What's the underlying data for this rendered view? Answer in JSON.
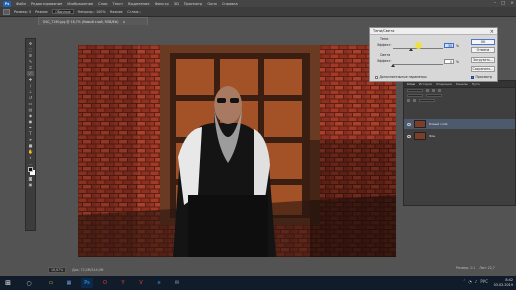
{
  "menubar": {
    "logo": "Ps",
    "items": [
      "Файл",
      "Редактирование",
      "Изображение",
      "Слои",
      "Текст",
      "Выделение",
      "Фильтр",
      "3D",
      "Просмотр",
      "Окно",
      "Справка"
    ]
  },
  "optionsbar": {
    "fields": [
      "Размер: 5",
      "Режим:",
      "Непрозр.: 100%",
      "Нажим:",
      "Сглаж.:"
    ],
    "mode_value": "Обычные"
  },
  "document": {
    "tab_title": "DSC_7190.jpg @ 16,7% (Новый слой, RGB/8#)",
    "close": "×"
  },
  "status": {
    "zoom": "16,67%",
    "doc_info": "Док: 72,0М/144,0М",
    "right_a": "Размер: 1:1",
    "right_b": "Лоп: 22,7"
  },
  "shadow_highlight_dialog": {
    "title": "Тени/Света",
    "close": "×",
    "shadows_label": "Тени",
    "amount1_label": "Эффект:",
    "amount1_value": "35",
    "highlights_label": "Света",
    "amount2_label": "Эффект:",
    "amount2_value": "0",
    "percent": "%",
    "ok": "OK",
    "cancel": "Отмена",
    "load": "Загрузить...",
    "save": "Сохранить...",
    "preview": "Просмотр",
    "more_options": "Дополнительные параметры",
    "amount1_fraction": 0.35,
    "amount2_fraction": 0.0
  },
  "layers_panel": {
    "tabs": [
      "Слои",
      "История",
      "Операции",
      "Каналы",
      "Пути"
    ],
    "active_tab": "Слои",
    "layers": [
      {
        "name": "Новый слой",
        "selected": true
      },
      {
        "name": "Фон",
        "selected": false
      }
    ]
  },
  "toolbox": {
    "tools": [
      "move-tool",
      "marquee-tool",
      "lasso-tool",
      "quick-select-tool",
      "crop-tool",
      "eyedropper-tool",
      "healing-tool",
      "brush-tool",
      "clone-tool",
      "history-brush-tool",
      "eraser-tool",
      "gradient-tool",
      "blur-tool",
      "dodge-tool",
      "pen-tool",
      "type-tool",
      "path-select-tool",
      "shape-tool",
      "hand-tool",
      "zoom-tool"
    ]
  },
  "taskbar": {
    "time": "8:42",
    "date": "03.02.2019",
    "lang": "РУС",
    "apps": [
      "explorer-icon",
      "store-icon",
      "photoshop-icon",
      "opera-icon",
      "yandex-icon",
      "vivaldi-icon",
      "edge-icon",
      "mail-icon"
    ]
  },
  "colors": {
    "accent_blue": "#3e6fd0",
    "ps_blue": "#1f63b0",
    "selected_layer": "#4d5a6d",
    "workspace": "#535353"
  }
}
